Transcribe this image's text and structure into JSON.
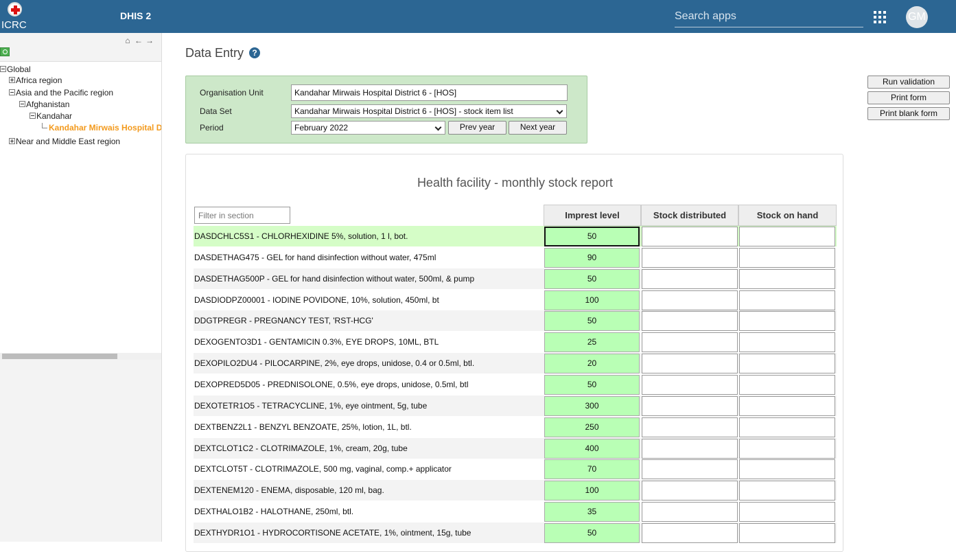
{
  "header": {
    "logo_text": "ICRC",
    "app_title": "DHIS 2",
    "search_placeholder": "Search apps",
    "apps_icon": "apps-grid-icon",
    "avatar_initials": "GM"
  },
  "sidebar": {
    "tree": [
      {
        "label": "Global",
        "level": 0,
        "expander": "minus"
      },
      {
        "label": "Africa region",
        "level": 1,
        "expander": "plus"
      },
      {
        "label": "Asia and the Pacific region",
        "level": 1,
        "expander": "minus"
      },
      {
        "label": "Afghanistan",
        "level": 2,
        "expander": "minus"
      },
      {
        "label": "Kandahar",
        "level": 3,
        "expander": "minus"
      },
      {
        "label": "Kandahar Mirwais Hospital D",
        "level": 4,
        "selected": true
      },
      {
        "label": "Near and Middle East region",
        "level": 1,
        "expander": "plus"
      }
    ]
  },
  "main": {
    "title": "Data Entry",
    "selection": {
      "org_unit_label": "Organisation Unit",
      "org_unit_value": "Kandahar Mirwais Hospital District 6 -  [HOS]",
      "dataset_label": "Data Set",
      "dataset_value": "Kandahar Mirwais Hospital District 6 - [HOS] - stock item list",
      "period_label": "Period",
      "period_value": "February 2022",
      "prev_year": "Prev year",
      "next_year": "Next year"
    },
    "actions": {
      "run_validation": "Run validation",
      "print_form": "Print form",
      "print_blank_form": "Print blank form"
    },
    "form": {
      "title": "Health facility - monthly stock report",
      "filter_placeholder": "Filter in section",
      "columns": [
        "Imprest level",
        "Stock distributed",
        "Stock on hand"
      ],
      "rows": [
        {
          "label": "DASDCHLC5S1 - CHLORHEXIDINE 5%, solution, 1 l, bot.",
          "impress": "50"
        },
        {
          "label": "DASDETHAG475 - GEL for hand disinfection without water, 475ml",
          "impress": "90"
        },
        {
          "label": "DASDETHAG500P - GEL for hand disinfection without water, 500ml, & pump",
          "impress": "50"
        },
        {
          "label": "DASDIODPZ00001 - IODINE POVIDONE, 10%, solution, 450ml, bt",
          "impress": "100"
        },
        {
          "label": "DDGTPREGR - PREGNANCY TEST, 'RST-HCG'",
          "impress": "50"
        },
        {
          "label": "DEXOGENTO3D1 - GENTAMICIN 0.3%, EYE DROPS, 10ML, BTL",
          "impress": "25"
        },
        {
          "label": "DEXOPILO2DU4 - PILOCARPINE, 2%, eye drops, unidose, 0.4 or 0.5ml, btl.",
          "impress": "20"
        },
        {
          "label": "DEXOPRED5D05 - PREDNISOLONE, 0.5%, eye drops, unidose, 0.5ml, btl",
          "impress": "50"
        },
        {
          "label": "DEXOTETR1O5 - TETRACYCLINE, 1%, eye ointment, 5g, tube",
          "impress": "300"
        },
        {
          "label": "DEXTBENZ2L1 - BENZYL BENZOATE, 25%, lotion, 1L, btl.",
          "impress": "250"
        },
        {
          "label": "DEXTCLOT1C2 - CLOTRIMAZOLE, 1%, cream, 20g, tube",
          "impress": "400"
        },
        {
          "label": "DEXTCLOT5T - CLOTRIMAZOLE, 500 mg, vaginal, comp.+ applicator",
          "impress": "70"
        },
        {
          "label": "DEXTENEM120 - ENEMA, disposable, 120 ml, bag.",
          "impress": "100"
        },
        {
          "label": "DEXTHALO1B2 - HALOTHANE, 250ml, btl.",
          "impress": "35"
        },
        {
          "label": "DEXTHYDR1O1 - HYDROCORTISONE ACETATE, 1%, ointment, 15g, tube",
          "impress": "50"
        }
      ]
    }
  }
}
